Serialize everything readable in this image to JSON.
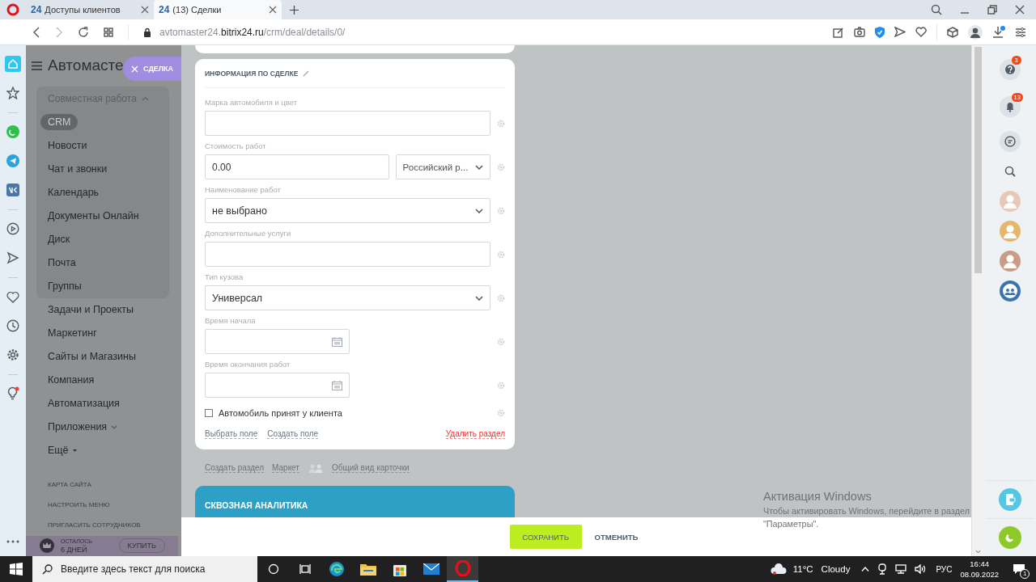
{
  "browser": {
    "tabs": [
      {
        "favicon_text": "24",
        "label": "Доступы клиентов",
        "selected": false
      },
      {
        "favicon_text": "24",
        "label": "(13) Сделки",
        "selected": true
      }
    ],
    "address": {
      "before": "avtomaster24.",
      "host": "bitrix24.ru",
      "after": "/crm/deal/details/0/"
    }
  },
  "sidebar": {
    "title": "Автомасте",
    "group": {
      "label": "Совместная работа",
      "expanded": true,
      "items": [
        {
          "label": "CRM",
          "selected": true
        },
        {
          "label": "Новости",
          "selected": false
        },
        {
          "label": "Чат и звонки",
          "selected": false
        },
        {
          "label": "Календарь",
          "selected": false
        },
        {
          "label": "Документы Онлайн",
          "selected": false
        },
        {
          "label": "Диск",
          "selected": false
        },
        {
          "label": "Почта",
          "selected": false
        },
        {
          "label": "Группы",
          "selected": false
        }
      ]
    },
    "items": [
      {
        "kind": "link",
        "label": "Задачи и Проекты"
      },
      {
        "kind": "link",
        "label": "Маркетинг"
      },
      {
        "kind": "link",
        "label": "Сайты и Магазины"
      },
      {
        "kind": "link",
        "label": "Компания"
      },
      {
        "kind": "link",
        "label": "Автоматизация"
      },
      {
        "kind": "submenu",
        "label": "Приложения"
      },
      {
        "kind": "more",
        "label": "Ещё"
      }
    ],
    "links": [
      "КАРТА САЙТА",
      "НАСТРОИТЬ МЕНЮ",
      "ПРИГЛАСИТЬ СОТРУДНИКОВ"
    ],
    "trial": {
      "caption": "ОСТАЛОСЬ",
      "days": "6 ДНЕЙ",
      "button": "КУПИТЬ"
    }
  },
  "slider_tab": {
    "label": "СДЕЛКА"
  },
  "section": {
    "title": "ИНФОРМАЦИЯ ПО СДЕЛКЕ",
    "fields": [
      {
        "kind": "text",
        "label": "Марка автомобиля и цвет"
      },
      {
        "kind": "money",
        "label": "Стоимость работ",
        "value": "0.00",
        "currency": "Российский р..."
      },
      {
        "kind": "select",
        "label": "Наименование работ",
        "value": "не выбрано"
      },
      {
        "kind": "text",
        "label": "Дополнительные услуги"
      },
      {
        "kind": "select",
        "label": "Тип кузова",
        "value": "Универсал"
      },
      {
        "kind": "date",
        "label": "Время начала"
      },
      {
        "kind": "date",
        "label": "Время окончания работ"
      },
      {
        "kind": "checkbox",
        "label": "Автомобиль принят у клиента",
        "checked": false
      }
    ],
    "actions": [
      "Выбрать поле",
      "Создать поле"
    ],
    "delete": "Удалить раздел"
  },
  "page_links": [
    "Создать раздел",
    "Маркет",
    "Общий вид карточки"
  ],
  "analytics": {
    "title": "СКВОЗНАЯ АНАЛИТИКА"
  },
  "footer": {
    "save": "СОХРАНИТЬ",
    "cancel": "ОТМЕНИТЬ"
  },
  "os_notice": {
    "title": "Активация Windows",
    "text": "Чтобы активировать Windows, перейдите в раздел \"Параметры\"."
  },
  "right_panel": {
    "help_badge": "3",
    "notify_badge": "13"
  },
  "taskbar": {
    "search_placeholder": "Введите здесь текст для поиска",
    "temperature": "11°C",
    "weather": "Cloudy",
    "language": "РУС",
    "time": "16:44",
    "date": "08.09.2022",
    "notification_count": "1"
  }
}
